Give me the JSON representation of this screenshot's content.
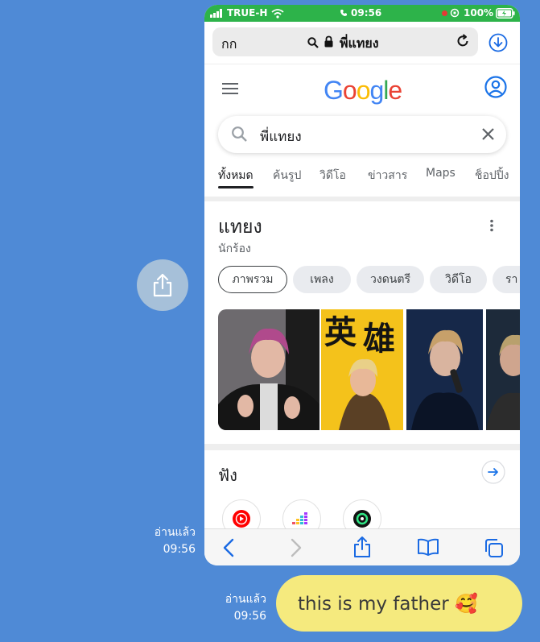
{
  "chat": {
    "read_label_1": "อ่านแล้ว",
    "time_1": "09:56",
    "read_label_2": "อ่านแล้ว",
    "time_2": "09:56",
    "message": "this is my father 🥰"
  },
  "phone": {
    "status": {
      "carrier": "TRUE-H",
      "time": "09:56",
      "battery": "100%"
    },
    "safari": {
      "aa_label": "กก",
      "url": "พี่แทยง"
    },
    "google": {
      "logo": "Google",
      "query": "พี่แทยง",
      "tabs": [
        "ทั้งหมด",
        "ค้นรูป",
        "วิดีโอ",
        "ข่าวสาร",
        "Maps",
        "ช็อปปิ้ง"
      ],
      "knowledge_title": "แทยง",
      "knowledge_subtitle": "นักร้อง",
      "chips": [
        "ภาพรวม",
        "เพลง",
        "วงดนตรี",
        "วิดีโอ",
        "รา"
      ],
      "listen_title": "ฟัง"
    }
  },
  "colors": {
    "chat_background": "#4f8ad6",
    "status_bar": "#2db34a",
    "bubble": "#f5ea7e",
    "ios_blue": "#1a6ae3",
    "google_blue": "#4285f4",
    "google_red": "#ea4335",
    "google_yellow": "#fbbc05",
    "google_green": "#34a853"
  },
  "icons": {
    "share_button": "share-icon",
    "url_search": "search-icon",
    "url_lock": "lock-icon",
    "reload": "reload-icon",
    "download": "download-icon",
    "menu": "hamburger-icon",
    "account": "account-circle-icon",
    "clear": "close-icon",
    "more": "more-vertical-icon",
    "listen_more": "arrow-right-icon",
    "music_apps": [
      "youtube-music-icon",
      "deezer-icon",
      "joox-icon"
    ],
    "toolbar": [
      "back-icon",
      "forward-icon",
      "share-icon",
      "bookmarks-icon",
      "tabs-icon"
    ]
  }
}
